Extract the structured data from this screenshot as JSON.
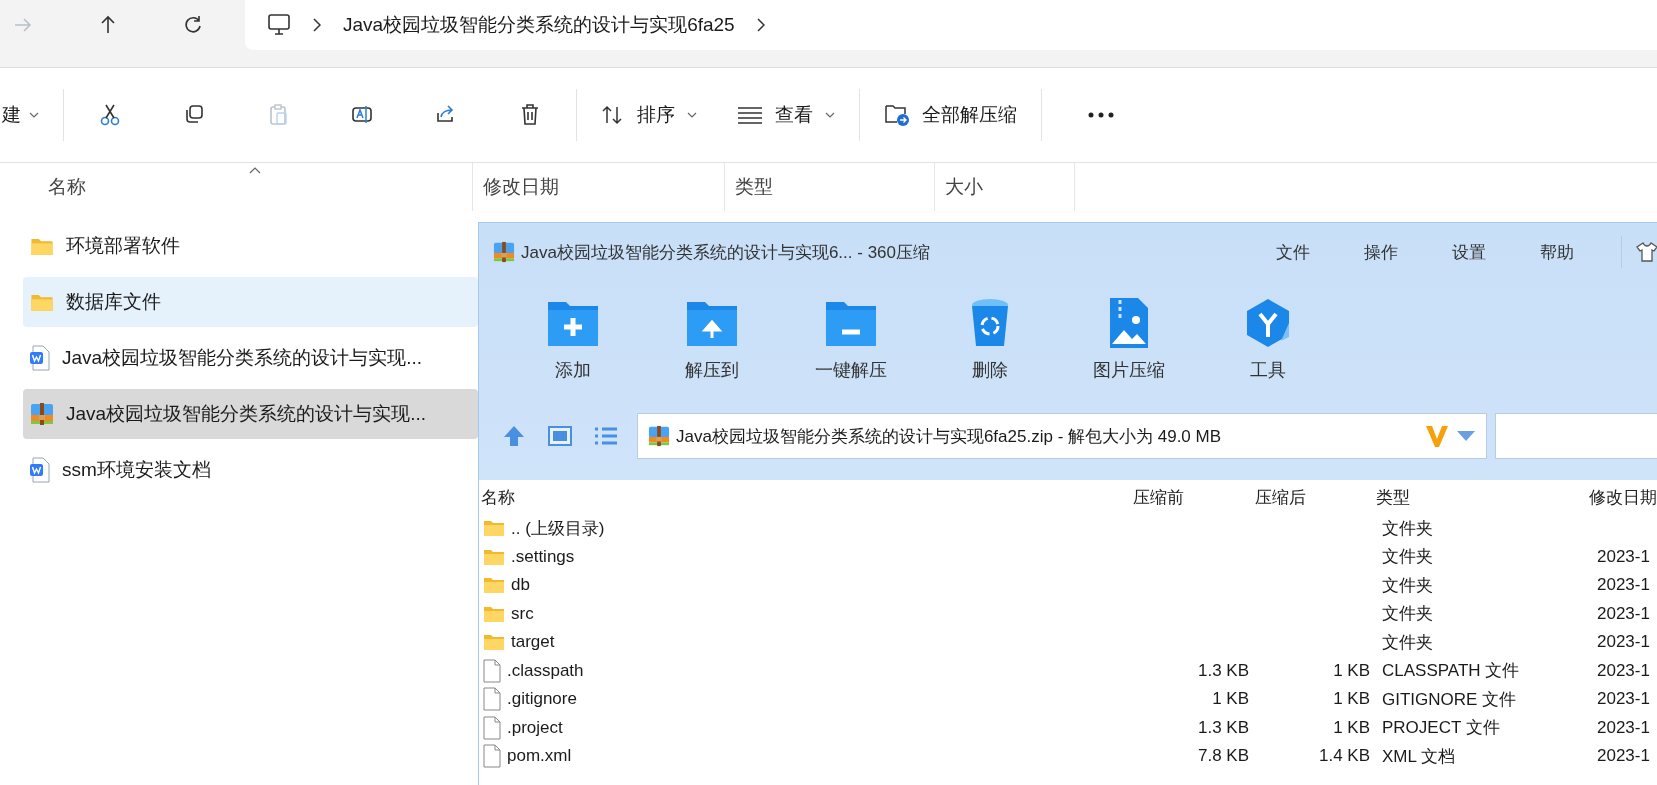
{
  "nav_buttons": [
    {
      "disabled": true
    },
    {
      "disabled": false
    },
    {
      "disabled": false
    }
  ],
  "address": {
    "path": "Java校园垃圾智能分类系统的设计与实现6fa25"
  },
  "toolbar": {
    "new_label": "建",
    "icon_buttons": [
      {
        "disabled": false
      },
      {
        "disabled": false
      },
      {
        "disabled": true
      },
      {
        "disabled": false
      },
      {
        "disabled": false
      },
      {
        "disabled": false
      }
    ],
    "sort_label": "排序",
    "view_label": "查看",
    "extract_label": "全部解压缩"
  },
  "columns": [
    "名称",
    "修改日期",
    "类型",
    "大小"
  ],
  "files": [
    {
      "kind": "folder",
      "name": "环境部署软件",
      "selected": false,
      "hovered": false
    },
    {
      "kind": "folder",
      "name": "数据库文件",
      "selected": false,
      "hovered": true
    },
    {
      "kind": "word",
      "name": "Java校园垃圾智能分类系统的设计与实现...",
      "selected": false,
      "hovered": false
    },
    {
      "kind": "zip",
      "name": "Java校园垃圾智能分类系统的设计与实现...",
      "selected": true,
      "hovered": false
    },
    {
      "kind": "word",
      "name": "ssm环境安装文档",
      "selected": false,
      "hovered": false
    }
  ],
  "archive": {
    "title": "Java校园垃圾智能分类系统的设计与实现6... - 360压缩",
    "menu": [
      "文件",
      "操作",
      "设置",
      "帮助"
    ],
    "actions": [
      "添加",
      "解压到",
      "一键解压",
      "删除",
      "图片压缩",
      "工具"
    ],
    "path": "Java校园垃圾智能分类系统的设计与实现6fa25.zip - 解包大小为 49.0 MB",
    "columns": [
      "名称",
      "压缩前",
      "压缩后",
      "类型",
      "修改日期"
    ],
    "rows": [
      {
        "kind": "folder",
        "name": ".. (上级目录)",
        "type": "文件夹"
      },
      {
        "kind": "folder",
        "name": ".settings",
        "type": "文件夹",
        "modified": "2023-1"
      },
      {
        "kind": "folder",
        "name": "db",
        "type": "文件夹",
        "modified": "2023-1"
      },
      {
        "kind": "folder",
        "name": "src",
        "type": "文件夹",
        "modified": "2023-1"
      },
      {
        "kind": "folder",
        "name": "target",
        "type": "文件夹",
        "modified": "2023-1"
      },
      {
        "kind": "file",
        "name": ".classpath",
        "size": "1.3 KB",
        "packed": "1 KB",
        "type": "CLASSPATH 文件",
        "modified": "2023-1"
      },
      {
        "kind": "file",
        "name": ".gitignore",
        "size": "1 KB",
        "packed": "1 KB",
        "type": "GITIGNORE 文件",
        "modified": "2023-1"
      },
      {
        "kind": "file",
        "name": ".project",
        "size": "1.3 KB",
        "packed": "1 KB",
        "type": "PROJECT 文件",
        "modified": "2023-1"
      },
      {
        "kind": "file",
        "name": "pom.xml",
        "size": "7.8 KB",
        "packed": "1.4 KB",
        "type": "XML 文档",
        "modified": "2023-1"
      }
    ]
  }
}
